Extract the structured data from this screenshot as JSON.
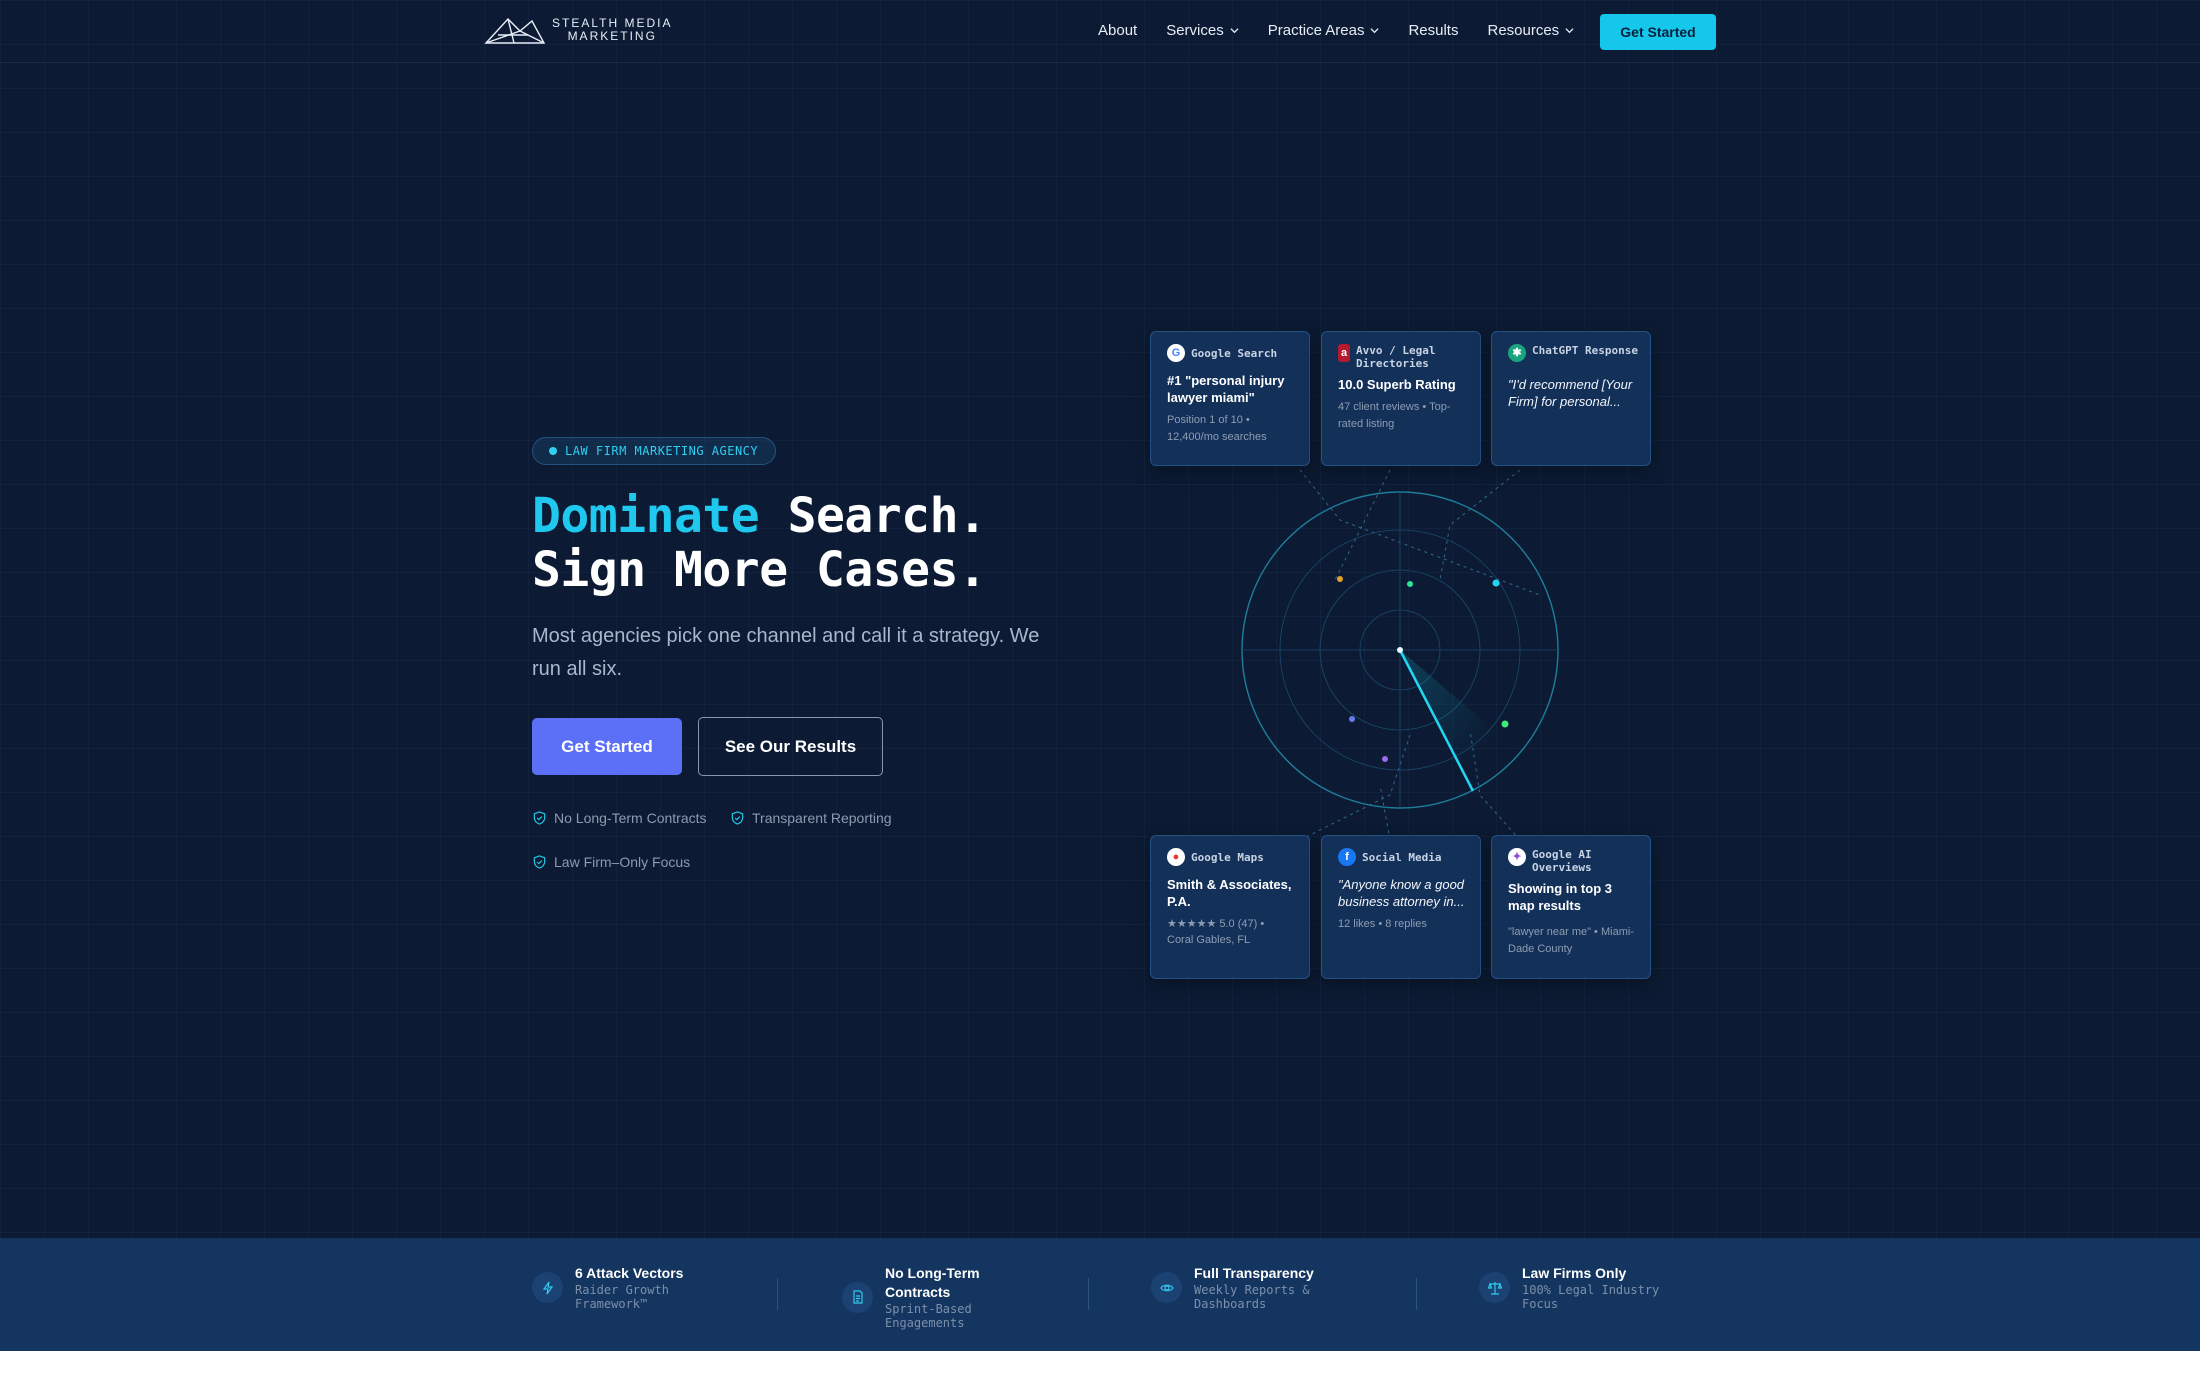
{
  "brand": {
    "name_line1": "STEALTH MEDIA",
    "name_line2": "MARKETING"
  },
  "nav": {
    "items": [
      {
        "label": "About",
        "dropdown": false
      },
      {
        "label": "Services",
        "dropdown": true
      },
      {
        "label": "Practice Areas",
        "dropdown": true
      },
      {
        "label": "Results",
        "dropdown": false
      },
      {
        "label": "Resources",
        "dropdown": true
      }
    ],
    "cta": "Get Started"
  },
  "hero": {
    "badge": "LAW FIRM MARKETING AGENCY",
    "headline_accent": "Dominate",
    "headline_rest1": " Search.",
    "headline_line2": "Sign More Cases.",
    "subheadline": "Most agencies pick one channel and call it a strategy. We run all six.",
    "primary_button": "Get Started",
    "secondary_button": "See Our Results",
    "trust_items": [
      "No Long-Term Contracts",
      "Transparent Reporting",
      "Law Firm–Only Focus"
    ]
  },
  "cards": {
    "google_search": {
      "header": "Google Search",
      "title": "#1 \"personal injury lawyer miami\"",
      "meta": "Position 1 of 10 • 12,400/mo searches",
      "icon": "google-icon"
    },
    "avvo": {
      "header": "Avvo / Legal Directories",
      "title": "10.0 Superb Rating",
      "meta": "47 client reviews • Top-rated listing",
      "icon": "avvo-icon"
    },
    "chatgpt": {
      "header": "ChatGPT Response",
      "title": "\"I'd recommend [Your Firm] for personal...",
      "meta": "",
      "icon": "chatgpt-icon"
    },
    "google_maps": {
      "header": "Google Maps",
      "title": "Smith & Associates, P.A.",
      "meta_rating": "★★★★★ 5.0 (47) •",
      "meta_location": "Coral Gables, FL",
      "icon": "map-pin-icon"
    },
    "social": {
      "header": "Social Media",
      "title": "\"Anyone know a good business attorney in...",
      "meta": "12 likes • 8 replies",
      "icon": "facebook-icon"
    },
    "google_ai": {
      "header": "Google AI Overviews",
      "title": "Showing in top 3 map results",
      "meta": "\"lawyer near me\" • Miami-Dade County",
      "icon": "ai-sparkle-icon"
    }
  },
  "features": [
    {
      "title": "6 Attack Vectors",
      "subtitle": "Raider Growth Framework™",
      "icon": "bolt-icon"
    },
    {
      "title": "No Long-Term Contracts",
      "subtitle": "Sprint-Based Engagements",
      "icon": "document-icon"
    },
    {
      "title": "Full Transparency",
      "subtitle": "Weekly Reports & Dashboards",
      "icon": "eye-icon"
    },
    {
      "title": "Law Firms Only",
      "subtitle": "100% Legal Industry Focus",
      "icon": "scale-icon"
    }
  ],
  "colors": {
    "background": "#0c1b33",
    "accent_cyan": "#16c7ec",
    "primary_button": "#5b6ff7",
    "card_bg": "#133059",
    "band_bg": "#13355f"
  }
}
